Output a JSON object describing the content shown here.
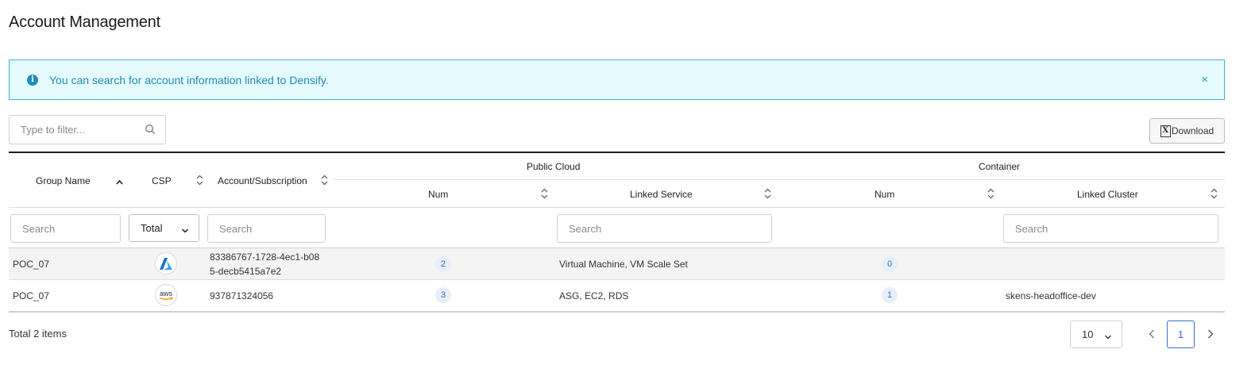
{
  "page": {
    "title": "Account Management"
  },
  "alert": {
    "message": "You can search for account information linked to Densify.",
    "close": "×",
    "info": "i"
  },
  "toolbar": {
    "filter_placeholder": "Type to filter...",
    "download_label": "Download",
    "excel_glyph": "X"
  },
  "table": {
    "headers": {
      "group_name": "Group Name",
      "csp": "CSP",
      "account": "Account/Subscription",
      "public_cloud": "Public Cloud",
      "container": "Container",
      "pc_num": "Num",
      "linked_service": "Linked Service",
      "ct_num": "Num",
      "linked_cluster": "Linked Cluster"
    },
    "search_placeholder": "Search",
    "csp_filter_value": "Total",
    "rows": [
      {
        "group_name": "POC_07",
        "csp": "azure-logo-icon",
        "account_line1": "83386767-1728-4ec1-b08",
        "account_line2": "5-decb5415a7e2",
        "pc_num": "2",
        "linked_service": "Virtual Machine, VM Scale Set",
        "ct_num": "0",
        "linked_cluster": ""
      },
      {
        "group_name": "POC_07",
        "csp": "aws-logo-icon",
        "account_line1": "937871324056",
        "account_line2": "",
        "pc_num": "3",
        "linked_service": "ASG, EC2, RDS",
        "ct_num": "1",
        "linked_cluster": "skens-headoffice-dev"
      }
    ]
  },
  "aws_logo_text": "aws",
  "footer": {
    "total": "Total 2 items",
    "page_size": "10",
    "current_page": "1"
  },
  "colors": {
    "alert_bg": "#e6fbfd",
    "alert_border": "#36b6cf",
    "alert_text": "#1a8db3",
    "active_page": "#3a6fd0",
    "badge_bg": "#e6eef9"
  }
}
